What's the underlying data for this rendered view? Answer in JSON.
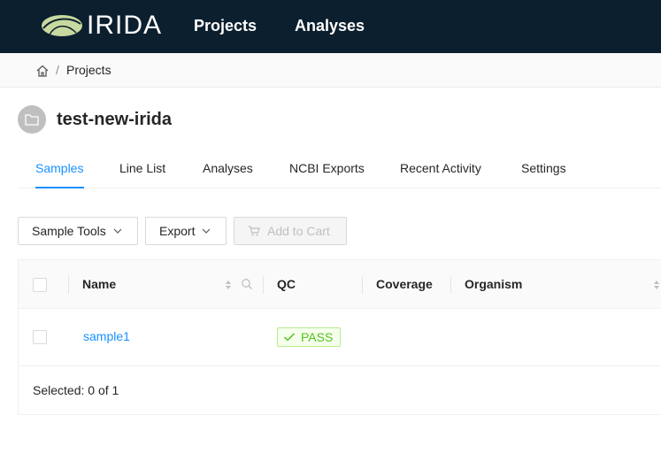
{
  "header": {
    "logo_text": "IRIDA",
    "nav": {
      "projects": "Projects",
      "analyses": "Analyses"
    },
    "colors": {
      "background": "#0c1f2e",
      "logo_leaf": "#c8d9a0"
    }
  },
  "breadcrumb": {
    "home_icon": "home-icon",
    "separator": "/",
    "current": "Projects"
  },
  "project": {
    "avatar_icon": "folder-icon",
    "title": "test-new-irida"
  },
  "tabs": {
    "samples": "Samples",
    "line_list": "Line List",
    "analyses": "Analyses",
    "ncbi_exports": "NCBI Exports",
    "recent_activity": "Recent Activity",
    "settings": "Settings",
    "active": "Samples",
    "accent": "#1890ff"
  },
  "toolbar": {
    "sample_tools": "Sample Tools",
    "export": "Export",
    "add_to_cart": "Add to Cart"
  },
  "table": {
    "columns": {
      "name": "Name",
      "qc": "QC",
      "coverage": "Coverage",
      "organism": "Organism"
    },
    "rows": [
      {
        "name": "sample1",
        "qc": "PASS",
        "coverage": "",
        "organism": ""
      }
    ],
    "footer": "Selected: 0 of 1"
  }
}
